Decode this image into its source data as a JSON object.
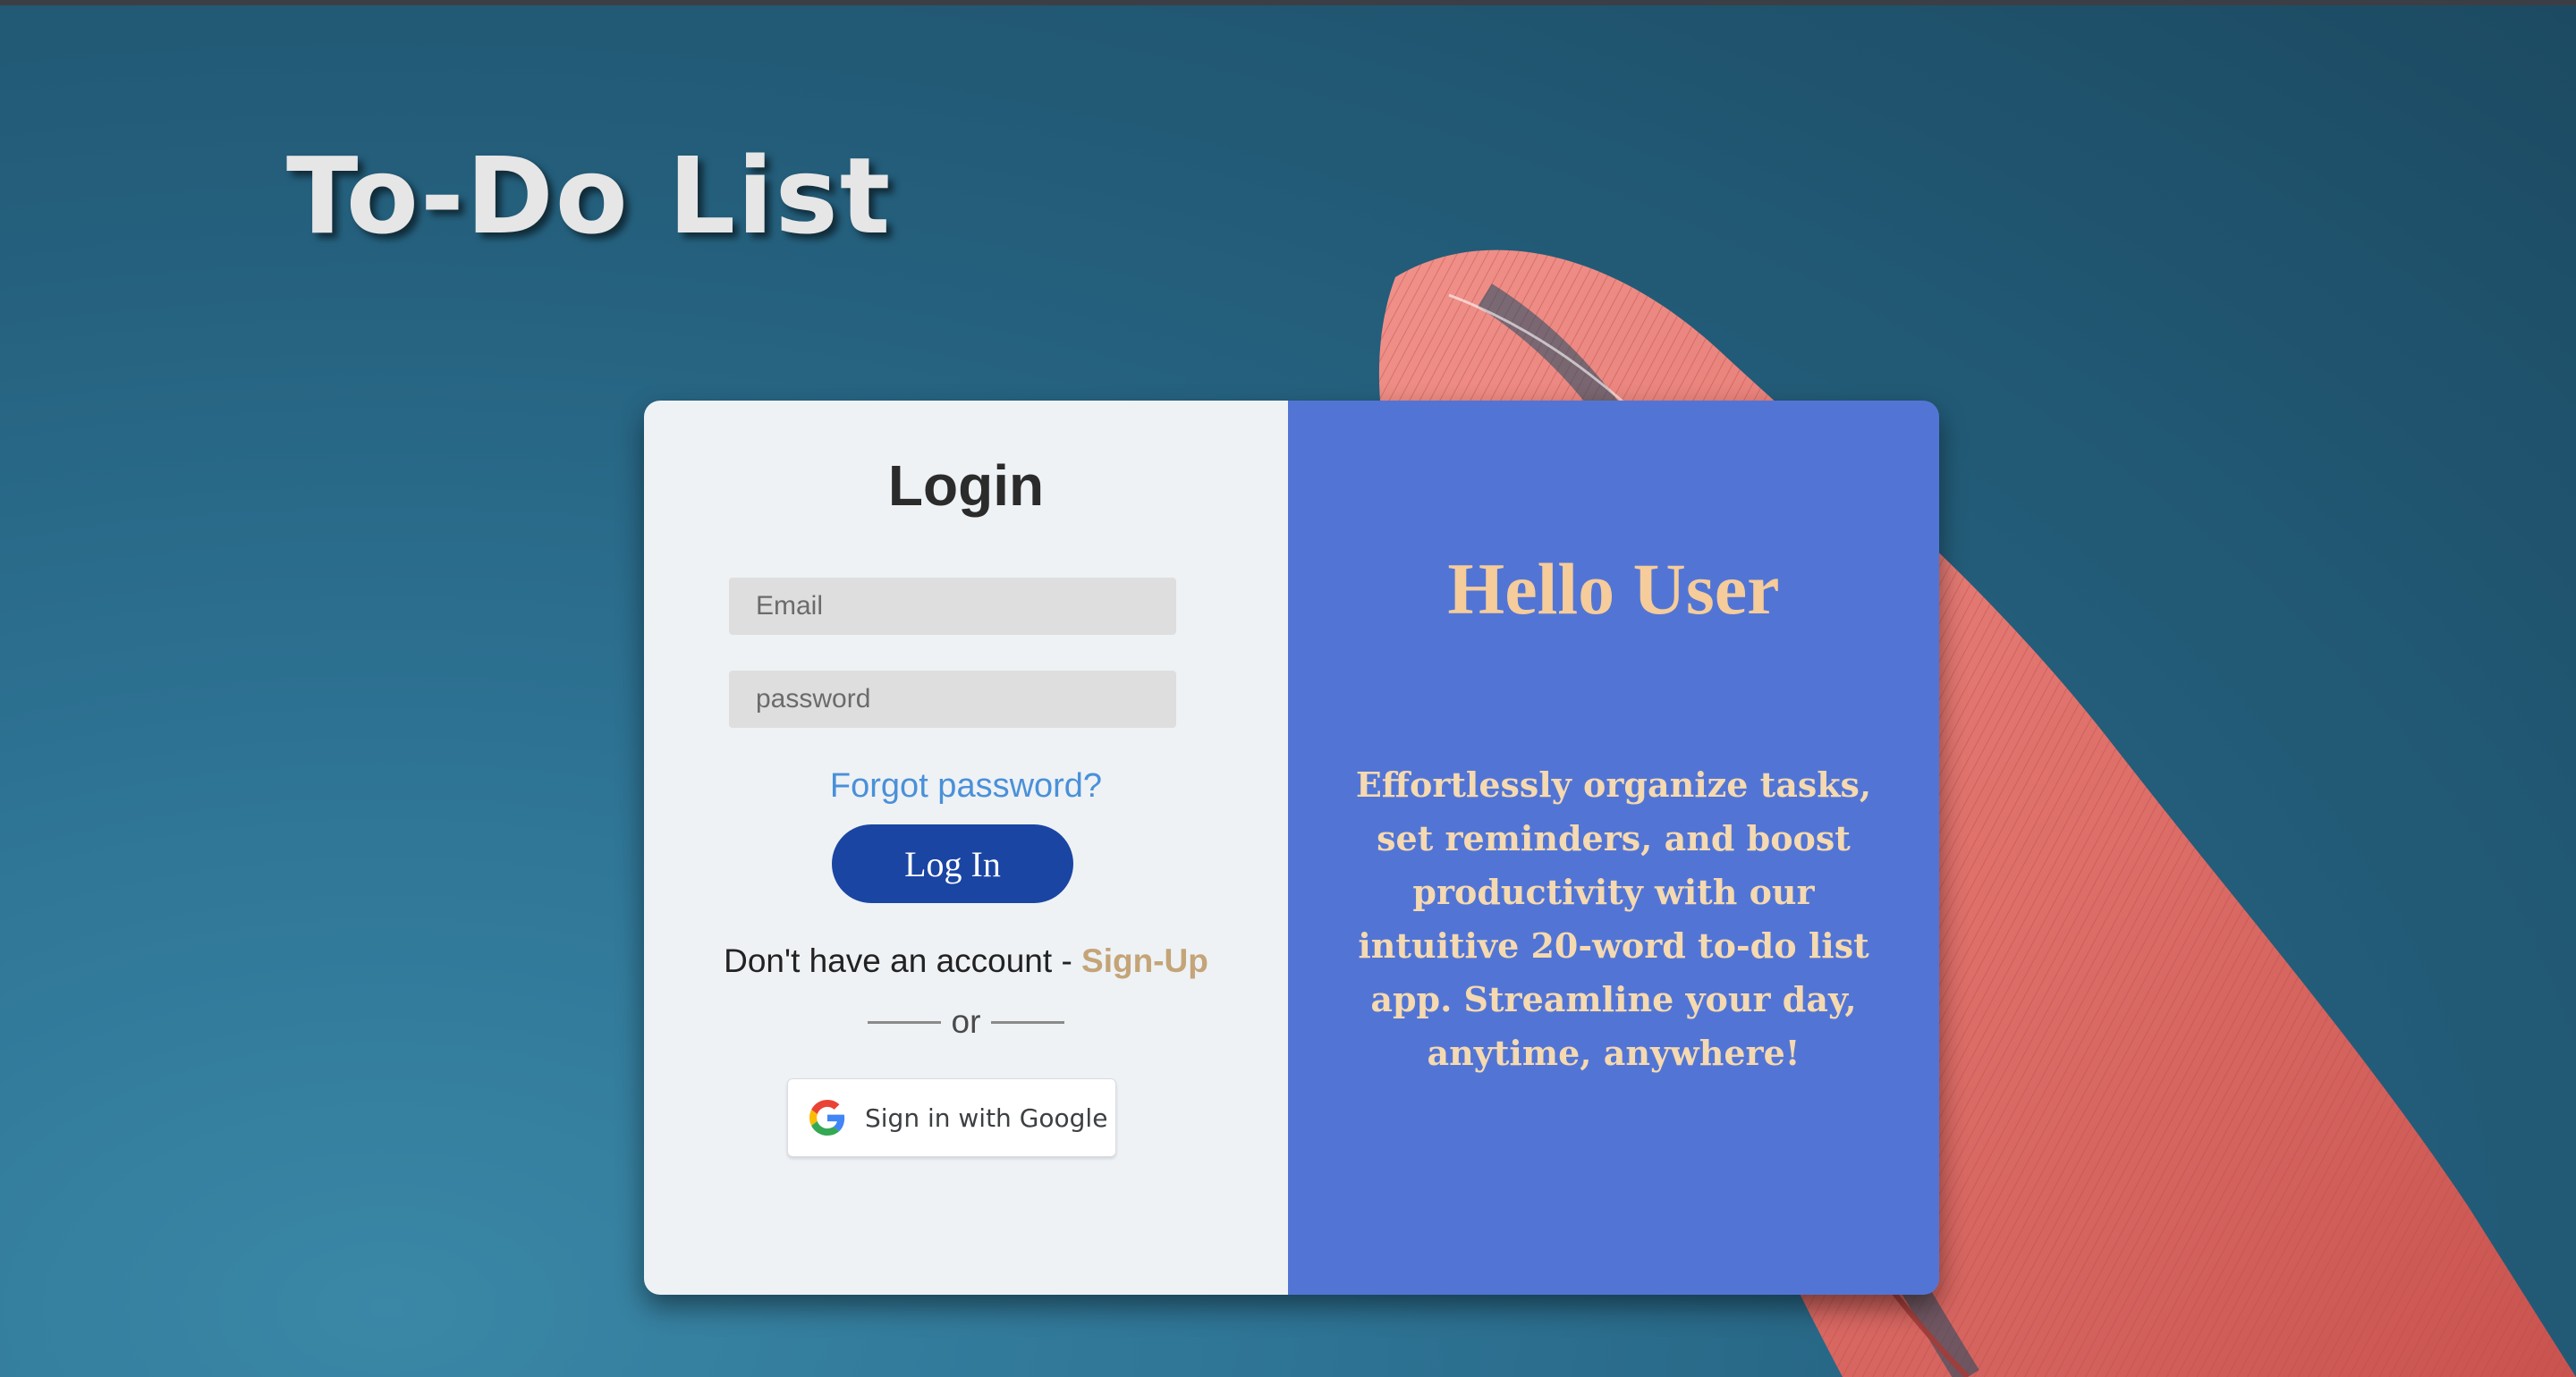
{
  "app": {
    "title": "To-Do List"
  },
  "login": {
    "heading": "Login",
    "email_placeholder": "Email",
    "password_placeholder": "password",
    "forgot_label": "Forgot password?",
    "submit_label": "Log In",
    "signup_prompt": "Don't have an account - ",
    "signup_label": "Sign-Up",
    "or_label": "or",
    "google_label": "Sign in with Google"
  },
  "info": {
    "heading": "Hello User",
    "text": "Effortlessly organize tasks, set reminders, and boost productivity with our intuitive 20-word to-do list app. Streamline your day, anytime, anywhere!"
  },
  "icons": {
    "google": "google-g-icon"
  },
  "colors": {
    "background": "#2a6a8a",
    "login_panel": "#eef2f5",
    "info_panel": "#5275d5",
    "login_button": "#1a45a3",
    "link": "#4a90d9",
    "signup_link": "#c4a478",
    "info_text": "#f5d9b0",
    "feather": "#e0726c"
  }
}
